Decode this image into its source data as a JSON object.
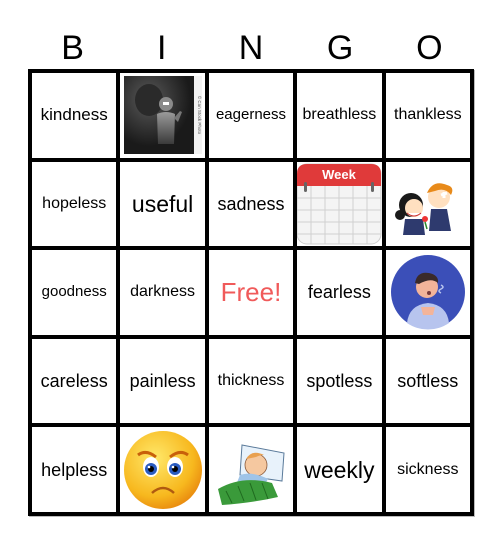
{
  "header": {
    "letters": [
      "B",
      "I",
      "N",
      "G",
      "O"
    ]
  },
  "colors": {
    "free_text": "#f05a5a",
    "grid_lines": "#000000",
    "calendar_red": "#e03a3a",
    "circle_blue": "#3b4fb8",
    "emoji_yellow": "#f7b81e"
  },
  "board": {
    "rows": [
      [
        {
          "type": "text",
          "text": "kindness"
        },
        {
          "type": "image",
          "icon": "dark-figure-image",
          "caption": "© Can Stock Photo"
        },
        {
          "type": "text",
          "text": "eagerness"
        },
        {
          "type": "text",
          "text": "breathless"
        },
        {
          "type": "text",
          "text": "thankless"
        }
      ],
      [
        {
          "type": "text",
          "text": "hopeless"
        },
        {
          "type": "text",
          "text": "useful"
        },
        {
          "type": "text",
          "text": "sadness"
        },
        {
          "type": "image",
          "icon": "calendar-week-image",
          "caption": "Week"
        },
        {
          "type": "image",
          "icon": "kids-giving-flower-image"
        }
      ],
      [
        {
          "type": "text",
          "text": "goodness"
        },
        {
          "type": "text",
          "text": "darkness"
        },
        {
          "type": "free",
          "text": "Free!"
        },
        {
          "type": "text",
          "text": "fearless"
        },
        {
          "type": "image",
          "icon": "breathless-boy-image"
        }
      ],
      [
        {
          "type": "text",
          "text": "careless"
        },
        {
          "type": "text",
          "text": "painless"
        },
        {
          "type": "text",
          "text": "thickness"
        },
        {
          "type": "text",
          "text": "spotless"
        },
        {
          "type": "text",
          "text": "softless"
        }
      ],
      [
        {
          "type": "text",
          "text": "helpless"
        },
        {
          "type": "image",
          "icon": "sad-face-image"
        },
        {
          "type": "image",
          "icon": "sick-child-in-bed-image"
        },
        {
          "type": "text",
          "text": "weekly"
        },
        {
          "type": "text",
          "text": "sickness"
        }
      ]
    ]
  }
}
